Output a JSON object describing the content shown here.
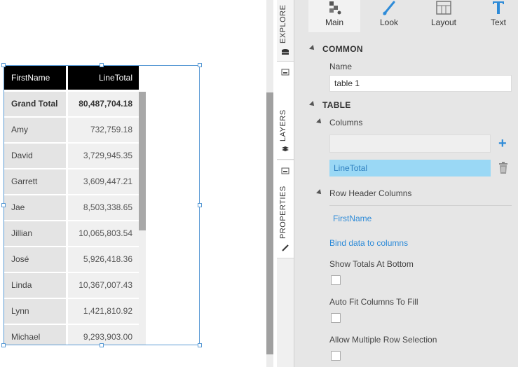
{
  "table": {
    "headers": {
      "first": "FirstName",
      "line": "LineTotal"
    },
    "rows": [
      {
        "first": "Grand Total",
        "line": "80,487,704.18"
      },
      {
        "first": "Amy",
        "line": "732,759.18"
      },
      {
        "first": "David",
        "line": "3,729,945.35"
      },
      {
        "first": "Garrett",
        "line": "3,609,447.21"
      },
      {
        "first": "Jae",
        "line": "8,503,338.65"
      },
      {
        "first": "Jillian",
        "line": "10,065,803.54"
      },
      {
        "first": "José",
        "line": "5,926,418.36"
      },
      {
        "first": "Linda",
        "line": "10,367,007.43"
      },
      {
        "first": "Lynn",
        "line": "1,421,810.92"
      },
      {
        "first": "Michael",
        "line": "9,293,903.00"
      }
    ]
  },
  "side_tabs": {
    "explore": "EXPLORE",
    "layers": "LAYERS",
    "properties": "PROPERTIES"
  },
  "toolbar": {
    "main": "Main",
    "look": "Look",
    "layout": "Layout",
    "text": "Text"
  },
  "properties": {
    "common_label": "COMMON",
    "name_label": "Name",
    "name_value": "table 1",
    "table_label": "TABLE",
    "columns_label": "Columns",
    "column_chip": "LineTotal",
    "row_header_label": "Row Header Columns",
    "row_header_value": "FirstName",
    "bind_link": "Bind data to columns",
    "show_totals": "Show Totals At Bottom",
    "auto_fit": "Auto Fit Columns To Fill",
    "multi_select": "Allow Multiple Row Selection"
  },
  "colors": {
    "accent": "#2e8bd8",
    "chip_bg": "#9ad8f5",
    "header_bg": "#000000"
  }
}
